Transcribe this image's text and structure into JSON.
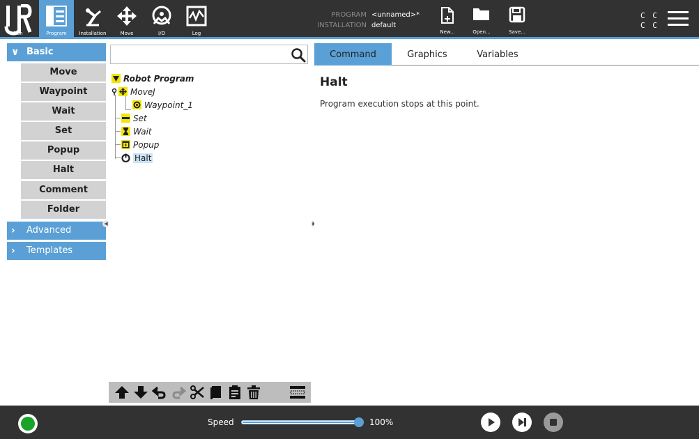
{
  "nav": {
    "run": "Run",
    "program": "Program",
    "installation": "Installation",
    "move": "Move",
    "io": "I/O",
    "log": "Log"
  },
  "header": {
    "program_key": "PROGRAM",
    "program_value": "<unnamed>*",
    "installation_key": "INSTALLATION",
    "installation_value": "default",
    "new_label": "New...",
    "open_label": "Open...",
    "save_label": "Save...",
    "cc_line1": "C C",
    "cc_line2": "C C"
  },
  "palette": {
    "basic": "Basic",
    "items": [
      "Move",
      "Waypoint",
      "Wait",
      "Set",
      "Popup",
      "Halt",
      "Comment",
      "Folder"
    ],
    "advanced": "Advanced",
    "templates": "Templates"
  },
  "tree": {
    "search_placeholder": "",
    "nodes": [
      "Robot Program",
      "MoveJ",
      "Waypoint_1",
      "Set",
      "Wait",
      "Popup",
      "Halt"
    ],
    "selected": "Halt"
  },
  "tabs": [
    "Command",
    "Graphics",
    "Variables"
  ],
  "active_tab": "Command",
  "command": {
    "title": "Halt",
    "description": "Program execution stops at this point."
  },
  "footer": {
    "speed_label": "Speed",
    "speed_value": "100%",
    "speed_fraction": 1.0
  },
  "colors": {
    "accent": "#5aa0d6",
    "topbar": "#323232",
    "tree_icon": "#f2e600",
    "status_ok": "#1aa32a"
  },
  "icons": {
    "search": "search-icon",
    "move_up": "arrow-up-icon",
    "move_down": "arrow-down-icon",
    "undo": "undo-icon",
    "redo": "redo-icon",
    "cut": "scissors-icon",
    "copy": "copy-icon",
    "paste": "paste-icon",
    "delete": "trash-icon",
    "suppress": "suppress-icon"
  }
}
